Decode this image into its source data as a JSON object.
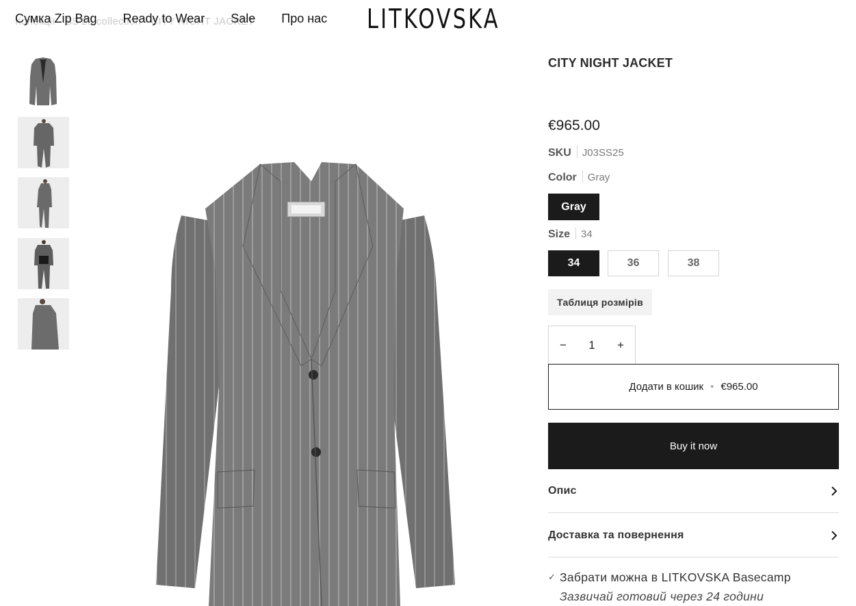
{
  "header": {
    "breadcrumb": "Колекції · SS'25 collection · CITY NIGHT JACKET",
    "nav": [
      "Сумка Zip Bag",
      "Ready to Wear",
      "Sale",
      "Про нас"
    ],
    "logo": "LITKOVSKA"
  },
  "gallery": {
    "thumbnails": [
      "jacket-front",
      "suit-full-front",
      "suit-side",
      "suit-back",
      "jacket-side-detail"
    ]
  },
  "product": {
    "title": "CITY NIGHT JACKET",
    "price": "€965.00",
    "sku_label": "SKU",
    "sku_value": "J03SS25",
    "color_label": "Color",
    "color_value": "Gray",
    "color_options": [
      "Gray"
    ],
    "size_label": "Size",
    "size_value": "34",
    "size_options": [
      "34",
      "36",
      "38"
    ],
    "size_chart": "Таблиця розмірів",
    "quantity": "1",
    "qty_minus": "−",
    "qty_plus": "+",
    "add_to_cart": "Додати в кошик",
    "add_to_cart_price": "€965.00",
    "buy_now": "Buy it now",
    "accordion": [
      "Опис",
      "Доставка та повернення"
    ],
    "pickup_text": "Забрати можна в",
    "pickup_location": "LITKOVSKA Basecamp",
    "pickup_note": "Зазвичай готовий через 24 години"
  },
  "colors": {
    "primary": "#1c1b1b",
    "border": "#d5d5d5",
    "muted": "#7a7a7a"
  }
}
